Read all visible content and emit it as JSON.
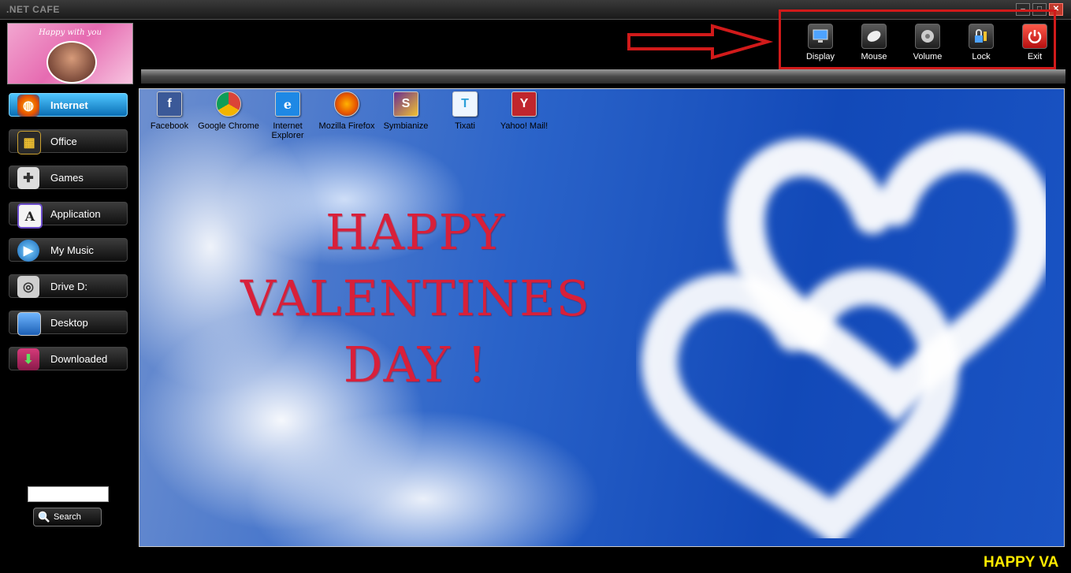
{
  "window": {
    "title": ".NET CAFE",
    "minimize": "‒",
    "maximize": "□",
    "close": "✕"
  },
  "logo": {
    "caption": "Happy with you"
  },
  "toolbar": {
    "items": [
      {
        "label": "Display",
        "icon": "monitor-icon"
      },
      {
        "label": "Mouse",
        "icon": "mouse-icon"
      },
      {
        "label": "Volume",
        "icon": "speaker-icon"
      },
      {
        "label": "Lock",
        "icon": "lock-icon"
      },
      {
        "label": "Exit",
        "icon": "power-icon"
      }
    ]
  },
  "sidebar": {
    "items": [
      {
        "label": "Internet",
        "icon": "firefox-icon",
        "active": true
      },
      {
        "label": "Office",
        "icon": "office-icon"
      },
      {
        "label": "Games",
        "icon": "gamepad-icon"
      },
      {
        "label": "Application",
        "icon": "application-icon"
      },
      {
        "label": "My Music",
        "icon": "media-player-icon"
      },
      {
        "label": "Drive D:",
        "icon": "drive-icon"
      },
      {
        "label": "Desktop",
        "icon": "desktop-icon"
      },
      {
        "label": "Downloaded",
        "icon": "download-icon"
      }
    ],
    "search": {
      "value": "",
      "button_label": "Search"
    }
  },
  "desktop": {
    "icons": [
      {
        "label": "Facebook",
        "icon": "facebook-icon",
        "glyph": "f",
        "color": "#3b5998"
      },
      {
        "label": "Google Chrome",
        "icon": "chrome-icon",
        "glyph": "◉",
        "color": "#34a853"
      },
      {
        "label": "Internet Explorer",
        "icon": "ie-icon",
        "glyph": "e",
        "color": "#1e88e5"
      },
      {
        "label": "Mozilla Firefox",
        "icon": "firefox-icon",
        "glyph": "◍",
        "color": "#e66000"
      },
      {
        "label": "Symbianize",
        "icon": "symbianize-icon",
        "glyph": "S",
        "color": "#6a2c91"
      },
      {
        "label": "Tixati",
        "icon": "tixati-icon",
        "glyph": "T",
        "color": "#2b9fd8"
      },
      {
        "label": "Yahoo! Mail!",
        "icon": "yahoo-mail-icon",
        "glyph": "Y",
        "color": "#c0262d"
      }
    ],
    "greeting": [
      "HAPPY",
      "VALENTINES",
      "DAY !"
    ]
  },
  "ticker": {
    "text": "HAPPY VA"
  },
  "colors": {
    "accent": "#1aa3ef",
    "highlight": "#d11a1a",
    "ticker": "#ffea00",
    "greeting": "#d8203a"
  }
}
